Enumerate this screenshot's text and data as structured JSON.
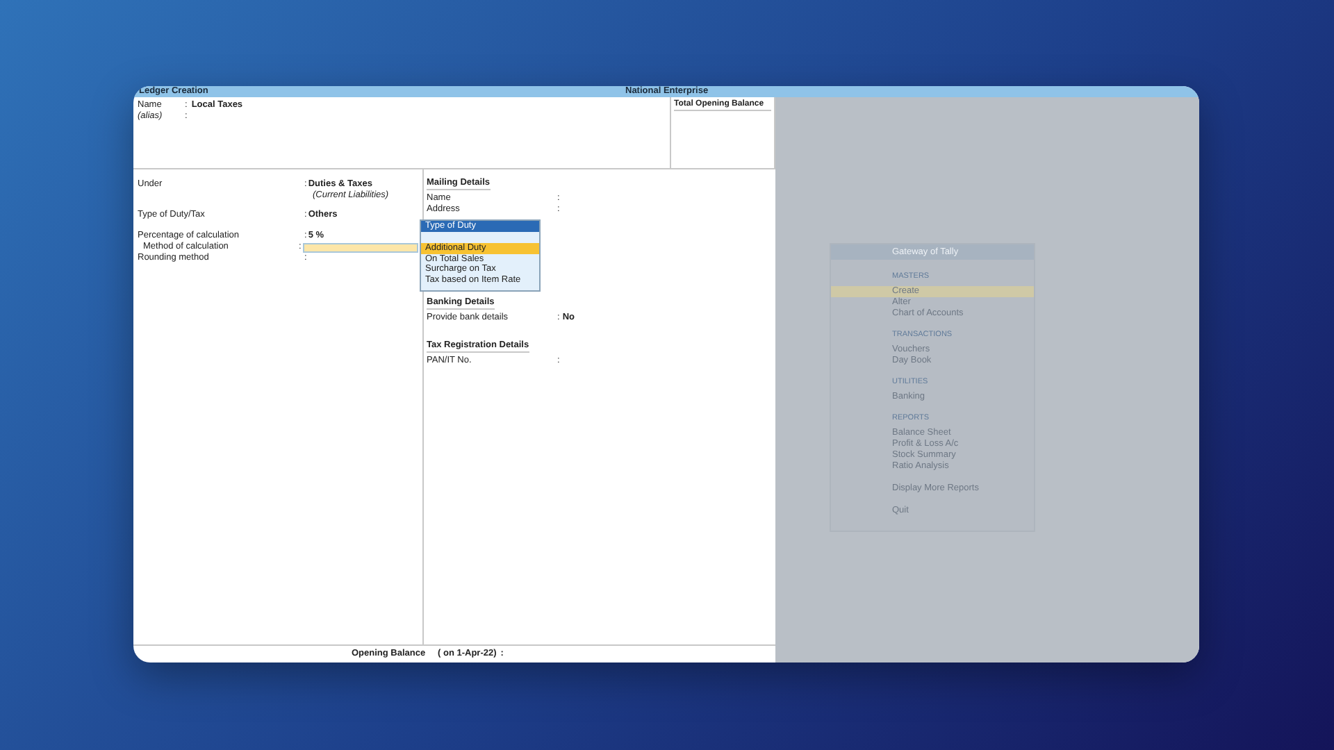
{
  "separator": ":",
  "title_bar": {
    "title": "Ledger Creation",
    "company": "National Enterprise"
  },
  "header_fields": [
    {
      "label": "Name",
      "value": "Local Taxes"
    },
    {
      "label": "(alias)"
    }
  ],
  "total_opening_balance": "Total Opening Balance",
  "left_fields": [
    {
      "kind": "text",
      "label": "Under",
      "value": "Duties & Taxes",
      "note": "(Current Liabilities)"
    },
    {
      "kind": "text",
      "label": "Type of Duty/Tax",
      "value": "Others"
    },
    {
      "kind": "text",
      "label": "Percentage of calculation",
      "value": "5 %"
    },
    {
      "kind": "field",
      "label": "Method of calculation"
    },
    {
      "kind": "text",
      "label": "Rounding method"
    }
  ],
  "mailing": {
    "heading": "Mailing Details",
    "fields": [
      {
        "label": "Name"
      },
      {
        "label": "Address"
      }
    ]
  },
  "dropdown": {
    "title": "Type of Duty",
    "options": [
      {
        "label": "Additional Duty",
        "selected": true
      },
      {
        "label": "On Total Sales",
        "selected": false
      },
      {
        "label": "Surcharge on Tax",
        "selected": false
      },
      {
        "label": "Tax based on Item Rate",
        "selected": false
      }
    ]
  },
  "banking": {
    "heading": "Banking Details",
    "fields": [
      {
        "label": "Provide bank details",
        "value": "No"
      }
    ]
  },
  "tax_registration": {
    "heading": "Tax Registration Details",
    "fields": [
      {
        "label": "PAN/IT No."
      }
    ]
  },
  "footer": {
    "label": "Opening Balance",
    "date": "( on 1-Apr-22)"
  },
  "gateway": {
    "title": "Gateway of Tally",
    "sections": [
      {
        "heading": "MASTERS",
        "items": [
          {
            "label": "Create",
            "selected": true
          },
          {
            "label": "Alter",
            "selected": false
          },
          {
            "label": "Chart of Accounts",
            "selected": false
          }
        ]
      },
      {
        "heading": "TRANSACTIONS",
        "items": [
          {
            "label": "Vouchers",
            "selected": false
          },
          {
            "label": "Day Book",
            "selected": false
          }
        ]
      },
      {
        "heading": "UTILITIES",
        "items": [
          {
            "label": "Banking",
            "selected": false
          }
        ]
      },
      {
        "heading": "REPORTS",
        "items": [
          {
            "label": "Balance Sheet",
            "selected": false
          },
          {
            "label": "Profit & Loss A/c",
            "selected": false
          },
          {
            "label": "Stock Summary",
            "selected": false
          },
          {
            "label": "Ratio Analysis",
            "selected": false
          }
        ]
      },
      {
        "items": [
          {
            "label": "Display More Reports",
            "selected": false
          }
        ]
      },
      {
        "items": [
          {
            "label": "Quit",
            "selected": false
          }
        ]
      }
    ]
  }
}
